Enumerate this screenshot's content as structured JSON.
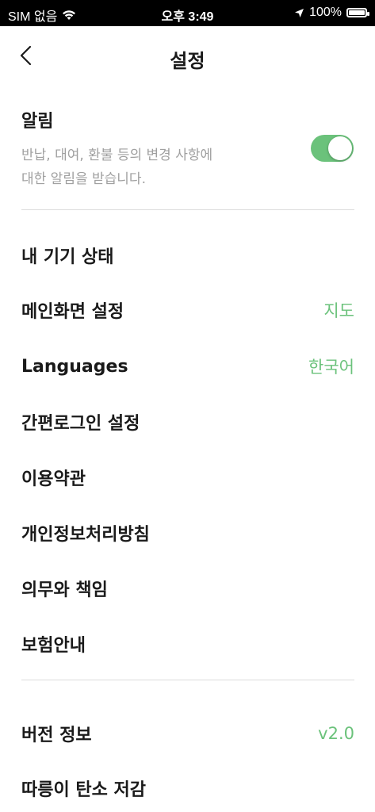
{
  "status_bar": {
    "carrier": "SIM 없음",
    "time": "오후 3:49",
    "battery": "100%",
    "battery_level": 1.0
  },
  "header": {
    "title": "설정",
    "back_icon": "chevron-left-icon"
  },
  "notification": {
    "title": "알림",
    "description": "반납, 대여, 환불 등의 변경 사항에 대한 알림을 받습니다.",
    "enabled": true
  },
  "menu": [
    {
      "label": "내 기기 상태",
      "value": ""
    },
    {
      "label": "메인화면 설정",
      "value": "지도"
    },
    {
      "label": "Languages",
      "value": "한국어"
    },
    {
      "label": "간편로그인 설정",
      "value": ""
    },
    {
      "label": "이용약관",
      "value": ""
    },
    {
      "label": "개인정보처리방침",
      "value": ""
    },
    {
      "label": "의무와 책임",
      "value": ""
    },
    {
      "label": "보험안내",
      "value": ""
    }
  ],
  "footer_menu": [
    {
      "label": "버전 정보",
      "value": "v2.0"
    },
    {
      "label": "따릉이 탄소 저감",
      "value": ""
    }
  ],
  "colors": {
    "accent": "#6bc27b",
    "muted_text": "#a0a0a0",
    "divider": "#dcdcdc"
  }
}
